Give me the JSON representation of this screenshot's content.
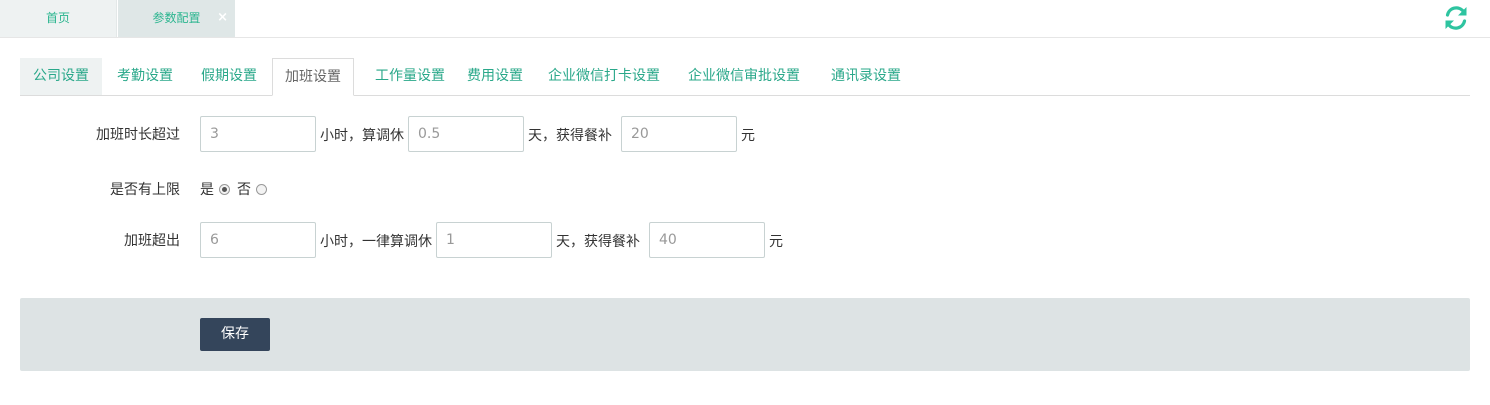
{
  "page_tabs": {
    "home": "首页",
    "active": "参数配置",
    "close": "×"
  },
  "setting_tabs": [
    "公司设置",
    "考勤设置",
    "假期设置",
    "加班设置",
    "工作量设置",
    "费用设置",
    "企业微信打卡设置",
    "企业微信审批设置",
    "通讯录设置"
  ],
  "form": {
    "row1": {
      "label": "加班时长超过",
      "hours": "3",
      "text1": "小时，算调休",
      "days": "0.5",
      "text2": "天，获得餐补",
      "meal": "20",
      "text3": "元"
    },
    "row2": {
      "label": "是否有上限",
      "yes": "是",
      "no": "否",
      "selected": "是"
    },
    "row3": {
      "label": "加班超出",
      "hours": "6",
      "text1": "小时，一律算调休",
      "days": "1",
      "text2": "天，获得餐补",
      "meal": "40",
      "text3": "元"
    }
  },
  "save_label": "保存",
  "colors": {
    "accent": "#2aa88a",
    "button": "#34455b",
    "footer": "#dde3e4"
  },
  "icons": {
    "refresh": "refresh-icon"
  }
}
